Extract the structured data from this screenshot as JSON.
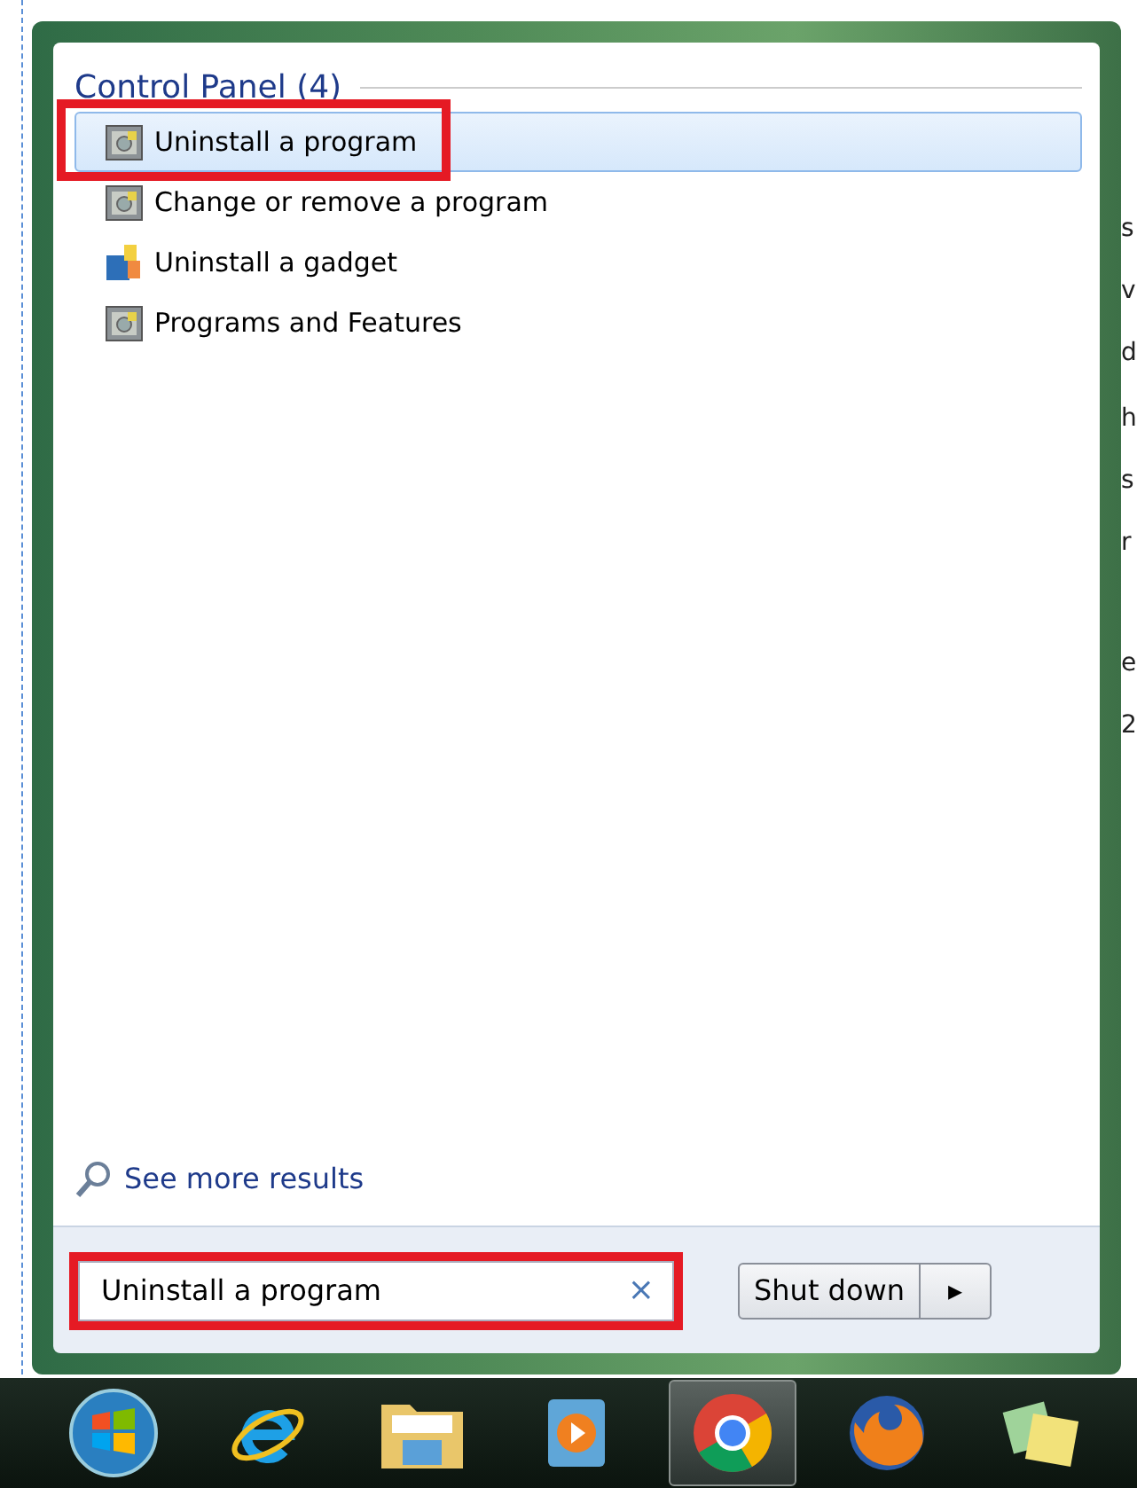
{
  "start_menu": {
    "group_title": "Control Panel (4)",
    "results": [
      {
        "label": "Uninstall a program",
        "kind": "programs",
        "selected": true,
        "highlighted": true
      },
      {
        "label": "Change or remove a program",
        "kind": "programs",
        "selected": false,
        "highlighted": false
      },
      {
        "label": "Uninstall a gadget",
        "kind": "gadget",
        "selected": false,
        "highlighted": false
      },
      {
        "label": "Programs and Features",
        "kind": "programs",
        "selected": false,
        "highlighted": false
      }
    ],
    "see_more": "See more results",
    "search": {
      "value": "Uninstall a program",
      "clear": "×",
      "highlighted": true
    },
    "shutdown": {
      "label": "Shut down",
      "arrow": "▸"
    }
  },
  "background_fragments": [
    "s",
    "v",
    "d",
    "h",
    "s",
    "r",
    "e",
    "2"
  ],
  "taskbar": [
    {
      "kind": "start",
      "selected": false
    },
    {
      "kind": "browser-e",
      "selected": false
    },
    {
      "kind": "folder",
      "selected": false
    },
    {
      "kind": "media",
      "selected": false
    },
    {
      "kind": "chrome",
      "selected": true
    },
    {
      "kind": "firefox",
      "selected": false
    },
    {
      "kind": "notes",
      "selected": false
    }
  ]
}
